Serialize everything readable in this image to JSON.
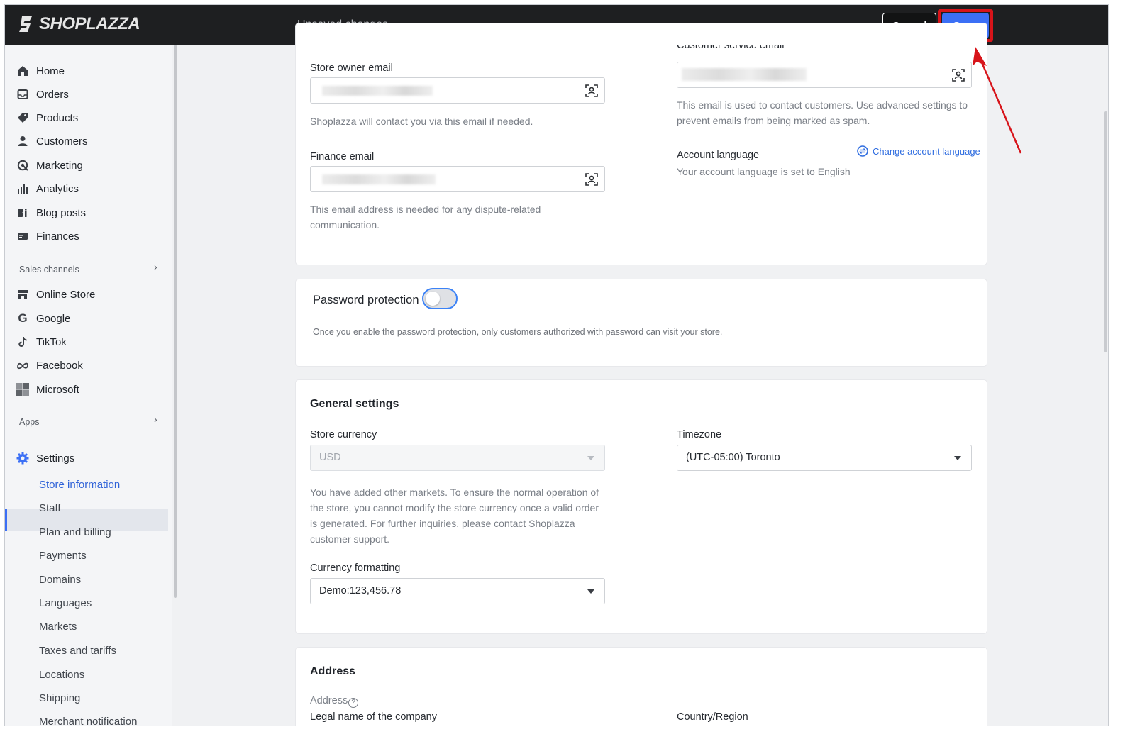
{
  "app": {
    "logo": "SHOPLAZZA"
  },
  "topbar": {
    "status": "Unsaved changes",
    "cancel_label": "Cancel",
    "save_label": "Save"
  },
  "sidebar": {
    "main_items": [
      {
        "label": "Home",
        "icon": "home-icon"
      },
      {
        "label": "Orders",
        "icon": "inbox-icon"
      },
      {
        "label": "Products",
        "icon": "tag-icon"
      },
      {
        "label": "Customers",
        "icon": "person-icon"
      },
      {
        "label": "Marketing",
        "icon": "marketing-icon"
      },
      {
        "label": "Analytics",
        "icon": "bar-chart-icon"
      },
      {
        "label": "Blog posts",
        "icon": "blog-icon"
      },
      {
        "label": "Finances",
        "icon": "finance-icon"
      }
    ],
    "sales_channels_title": "Sales channels",
    "sales_channels": [
      {
        "label": "Online Store",
        "icon": "store-icon"
      },
      {
        "label": "Google",
        "icon": "google-icon"
      },
      {
        "label": "TikTok",
        "icon": "tiktok-icon"
      },
      {
        "label": "Facebook",
        "icon": "meta-icon"
      },
      {
        "label": "Microsoft",
        "icon": "microsoft-icon"
      }
    ],
    "apps_title": "Apps",
    "settings_label": "Settings",
    "settings_items": [
      "Store information",
      "Staff",
      "Plan and billing",
      "Payments",
      "Domains",
      "Languages",
      "Markets",
      "Taxes and tariffs",
      "Locations",
      "Shipping",
      "Merchant notification"
    ],
    "active_settings_item": "Store information"
  },
  "contact": {
    "customer_service_label": "Customer service email",
    "store_owner_label": "Store owner email",
    "store_owner_help": "Shoplazza will contact you via this email if needed.",
    "finance_label": "Finance email",
    "finance_help": "This email address is needed for any dispute-related communication.",
    "cs_help": "This email is used to contact customers. Use advanced settings to prevent emails from being marked as spam.",
    "account_language_label": "Account language",
    "change_language_link": "Change account language",
    "account_language_text": "Your account language is set to English"
  },
  "password": {
    "title": "Password protection",
    "enabled": false,
    "help": "Once you enable the password protection, only customers authorized with password can visit your store."
  },
  "general": {
    "title": "General settings",
    "currency_label": "Store currency",
    "currency_value": "USD",
    "currency_help": "You have added other markets. To ensure the normal operation of the store, you cannot modify the store currency once a valid order is generated. For further inquiries, please contact Shoplazza customer support.",
    "timezone_label": "Timezone",
    "timezone_value": "(UTC-05:00) Toronto",
    "formatting_label": "Currency formatting",
    "formatting_value": "Demo:123,456.78"
  },
  "address": {
    "title": "Address",
    "address_label": "Address",
    "legal_name_label": "Legal name of the company",
    "country_label": "Country/Region"
  },
  "colors": {
    "accent": "#3b6ff5",
    "highlight": "#d7141a",
    "topbar": "#1e1f21"
  }
}
